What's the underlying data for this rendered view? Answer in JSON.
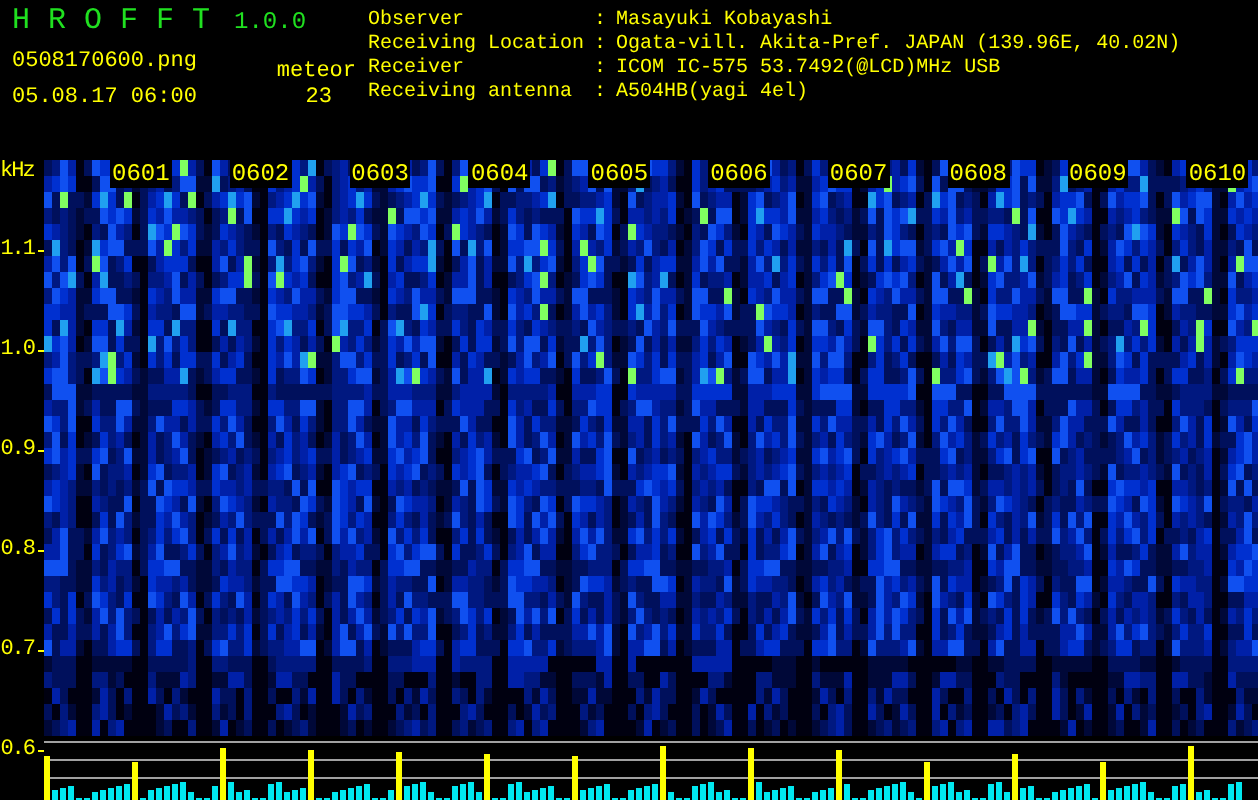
{
  "header": {
    "app_name": "H R O F F T",
    "version": "1.0.0",
    "file_name": "0508170600.png",
    "timestamp": "05.08.17 06:00",
    "meteor_label": "meteor",
    "meteor_count": "23"
  },
  "station_info": [
    {
      "label": "Observer",
      "separator": ":",
      "value": "Masayuki Kobayashi"
    },
    {
      "label": "Receiving Location",
      "separator": ":",
      "value": "Ogata-vill. Akita-Pref. JAPAN (139.96E, 40.02N)"
    },
    {
      "label": "Receiver",
      "separator": ":",
      "value": "ICOM IC-575 53.7492(@LCD)MHz USB"
    },
    {
      "label": "Receiving antenna",
      "separator": ":",
      "value": "A504HB(yagi 4el)"
    }
  ],
  "spectrogram": {
    "unit": "kHz",
    "frequency_labels": [
      "1.1",
      "1.0",
      "0.9",
      "0.8",
      "0.7",
      "0.6"
    ],
    "time_labels": [
      "0601",
      "0602",
      "0603",
      "0604",
      "0605",
      "0606",
      "0607",
      "0608",
      "0609",
      "0610"
    ]
  }
}
